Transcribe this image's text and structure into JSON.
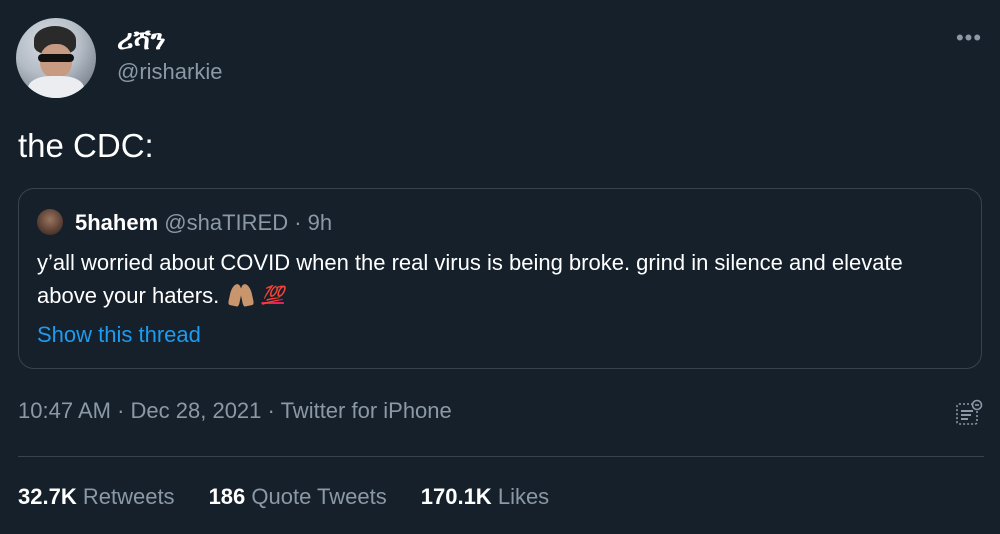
{
  "tweet": {
    "author": {
      "display_name": "ሪሻን",
      "handle": "@risharkie"
    },
    "text": "the CDC:",
    "timestamp": "10:47 AM",
    "date": "Dec 28, 2021",
    "source": "Twitter for iPhone",
    "meta_separator": "·"
  },
  "quoted_tweet": {
    "display_name": "5hahem",
    "handle": "@shaTIRED",
    "separator": "·",
    "time": "9h",
    "text": "y’all worried about COVID when the real virus is being broke. grind in silence and elevate above your haters.",
    "emoji_2": "💯",
    "show_thread_label": "Show this thread"
  },
  "stats": {
    "retweets_count": "32.7K",
    "retweets_label": "Retweets",
    "quotes_count": "186",
    "quotes_label": "Quote Tweets",
    "likes_count": "170.1K",
    "likes_label": "Likes"
  },
  "icons": {
    "more": "more-horizontal-icon",
    "analytics": "view-analytics-icon"
  },
  "colors": {
    "background": "#15202b",
    "muted_text": "#8b98a5",
    "link": "#1d9bf0",
    "border": "#38444d"
  }
}
